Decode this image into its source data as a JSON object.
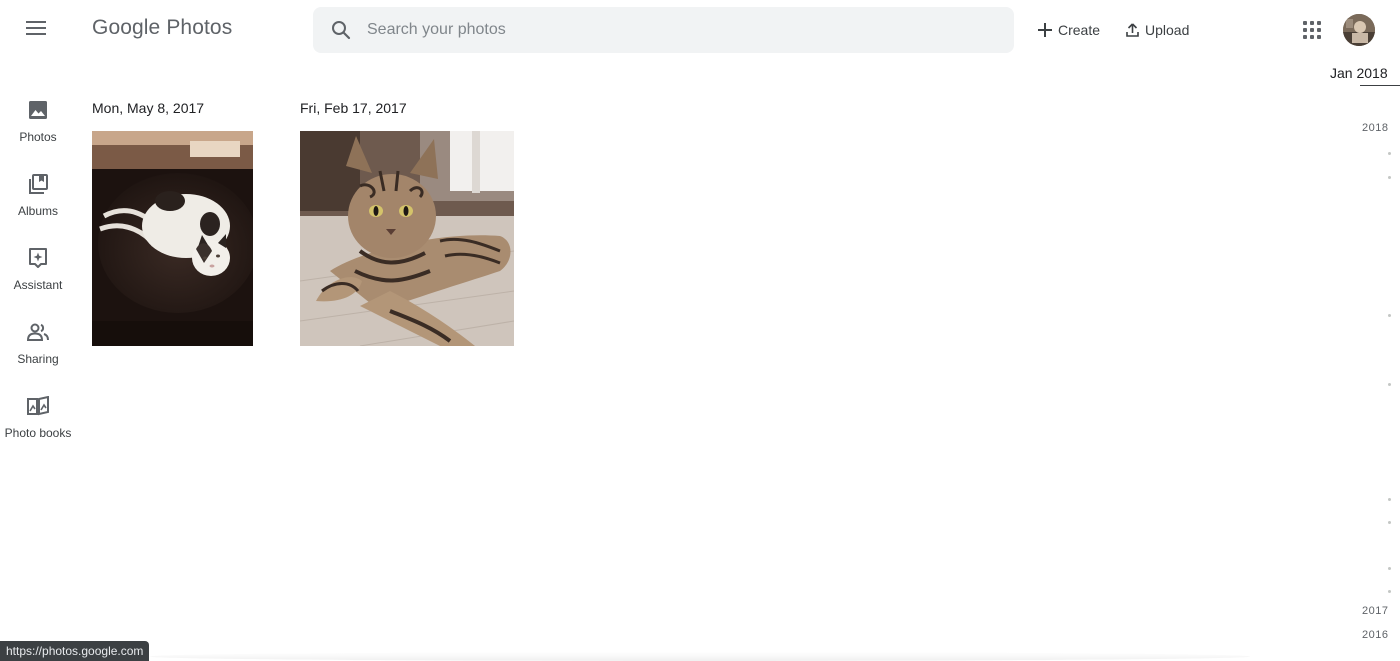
{
  "header": {
    "logo_google": "Google",
    "logo_photos": "Photos",
    "search_placeholder": "Search your photos",
    "create_label": "Create",
    "upload_label": "Upload",
    "icons": {
      "menu": "hamburger-menu-icon",
      "search": "search-icon",
      "create": "plus-icon",
      "upload": "upload-icon",
      "apps": "apps-grid-icon"
    }
  },
  "sidebar": {
    "items": [
      {
        "label": "Photos",
        "icon": "photo-icon"
      },
      {
        "label": "Albums",
        "icon": "albums-icon"
      },
      {
        "label": "Assistant",
        "icon": "assistant-icon"
      },
      {
        "label": "Sharing",
        "icon": "sharing-icon"
      },
      {
        "label": "Photo books",
        "icon": "photo-book-icon"
      }
    ]
  },
  "groups": [
    {
      "date": "Mon, May 8, 2017",
      "photo": "white-black-cat-on-blanket"
    },
    {
      "date": "Fri, Feb 17, 2017",
      "photo": "bengal-cat-on-floor"
    }
  ],
  "timeline": {
    "current": "Jan 2018",
    "years": [
      "2018",
      "2017",
      "2016"
    ]
  },
  "status_url": "https://photos.google.com",
  "colors": {
    "google_blue": "#4285f4",
    "google_red": "#ea4335",
    "google_yellow": "#fbbc05",
    "google_green": "#34a853",
    "search_bg": "#f1f3f4",
    "icon_gray": "#5f6368"
  }
}
